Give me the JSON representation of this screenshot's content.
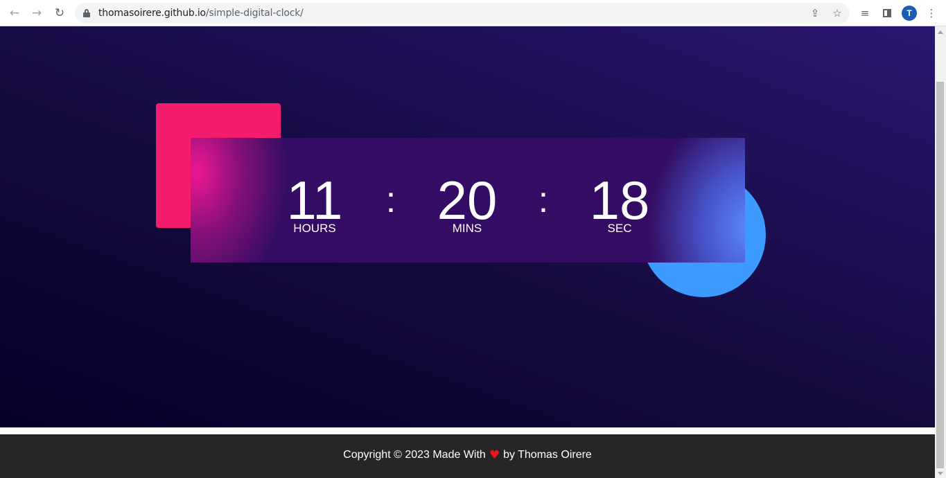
{
  "browser": {
    "url_host": "thomasoirere.github.io",
    "url_path": "/simple-digital-clock/",
    "avatar_letter": "T",
    "icons": [
      "back-icon",
      "forward-icon",
      "reload-icon",
      "lock-icon",
      "share-icon",
      "star-icon",
      "reading-list-icon",
      "side-panel-icon",
      "menu-icon"
    ]
  },
  "clock": {
    "hours": "11",
    "minutes": "20",
    "seconds": "18",
    "separator": ":",
    "hours_label": "HOURS",
    "minutes_label": "MINS",
    "seconds_label": "SEC"
  },
  "footer": {
    "prefix": "Copyright © 2023 Made With",
    "heart": "♥",
    "suffix": "by Thomas Oirere"
  },
  "colors": {
    "pink_square": "#f41c6d",
    "blue_circle": "#3d9bff",
    "footer_bg": "#262626",
    "heart": "#e8161d"
  }
}
